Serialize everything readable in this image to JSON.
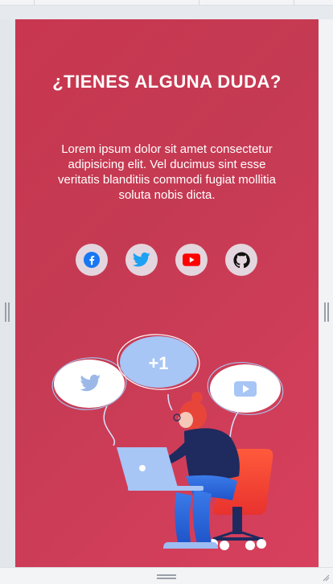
{
  "section": {
    "title": "¿TIENES ALGUNA DUDA?",
    "description": "Lorem ipsum dolor sit amet consectetur adipisicing elit. Vel ducimus sint esse veritatis blanditiis commodi fugiat mollitia soluta nobis dicta."
  },
  "socials": [
    {
      "name": "facebook",
      "icon": "facebook-icon",
      "color": "#1877f2"
    },
    {
      "name": "twitter",
      "icon": "twitter-icon",
      "color": "#1da1f2"
    },
    {
      "name": "youtube",
      "icon": "youtube-icon",
      "color": "#ff0000"
    },
    {
      "name": "github",
      "icon": "github-icon",
      "color": "#111111"
    }
  ],
  "illustration": {
    "bubble_label": "+1",
    "icons": [
      "twitter-icon",
      "youtube-icon"
    ]
  },
  "colors": {
    "panel_gradient_start": "#c8374f",
    "panel_gradient_end": "#d8405d",
    "social_button_bg": "#e4d6de"
  }
}
